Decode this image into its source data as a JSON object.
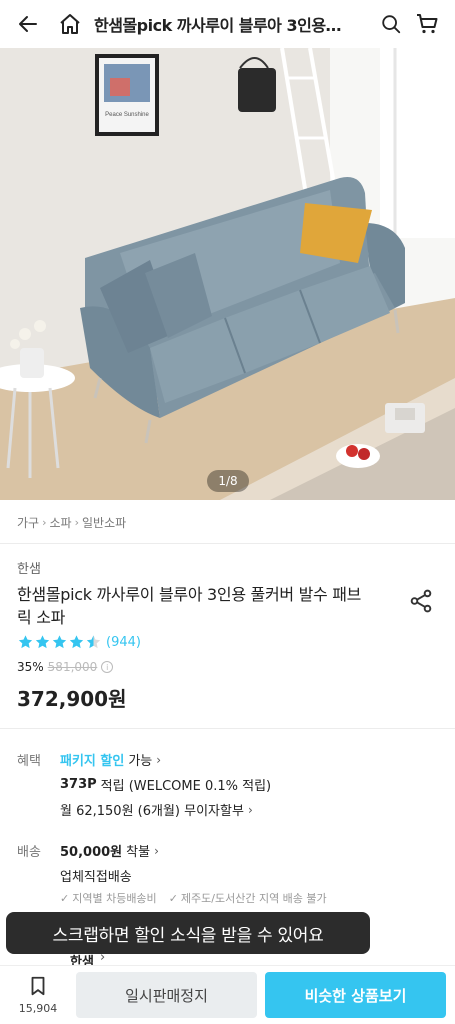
{
  "header": {
    "title": "한샘몰pick 까사루이 블루아 3인용…"
  },
  "hero": {
    "counter": "1/8",
    "poster_text": "Peace Sunshine"
  },
  "breadcrumb": [
    "가구",
    "소파",
    "일반소파"
  ],
  "product": {
    "brand": "한샘",
    "title": "한샘몰pick 까사루이 블루아 3인용 풀커버 발수 패브릭 소파",
    "rating": 4.5,
    "review_count": "(944)",
    "discount_rate": "35%",
    "original_price": "581,000",
    "price": "372,900원"
  },
  "benefit": {
    "label": "혜택",
    "package": "패키지 할인",
    "package_suffix": "가능",
    "points": "373P",
    "points_text": "적립 (WELCOME 0.1% 적립)",
    "installment": "월 62,150원 (6개월) 무이자할부"
  },
  "delivery": {
    "label": "배송",
    "fee": "50,000원",
    "fee_suffix": "착불",
    "method": "업체직접배송",
    "notes": [
      "지역별 차등배송비",
      "제주도/도서산간 지역 배송 불가"
    ]
  },
  "toast": "스크랩하면 할인 소식을 받을 수 있어요",
  "underlay_text": "한샘",
  "bottom": {
    "scrap_count": "15,904",
    "sold_out_label": "일시판매정지",
    "similar_label": "비슷한 상품보기"
  },
  "colors": {
    "accent": "#35c5f0",
    "sofa": "#7f95a3",
    "pillow": "#e0a63a"
  }
}
